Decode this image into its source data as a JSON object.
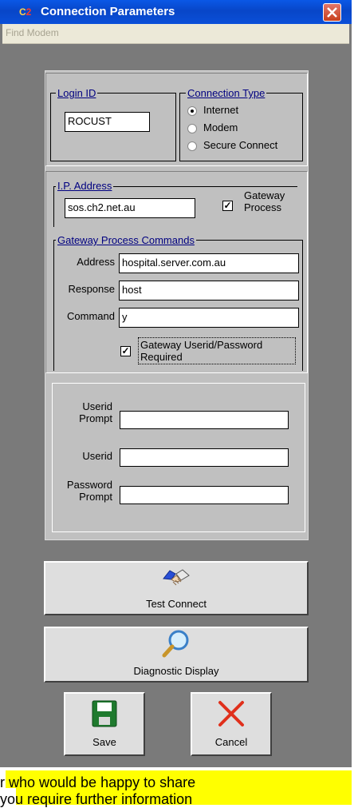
{
  "window": {
    "title": "Connection Parameters",
    "menu": {
      "find_modem": "Find Modem"
    }
  },
  "login": {
    "legend": "Login ID",
    "value": "ROCUST"
  },
  "connection_type": {
    "legend": "Connection Type",
    "options": [
      "Internet",
      "Modem",
      "Secure Connect"
    ],
    "selected": "Internet"
  },
  "ip": {
    "legend": "I.P. Address",
    "value": "sos.ch2.net.au",
    "gateway_process_label": "Gateway Process",
    "gateway_process_checked": true
  },
  "gateway_commands": {
    "legend": "Gateway Process Commands",
    "address_label": "Address",
    "address_value": "hospital.server.com.au",
    "response_label": "Response",
    "response_value": "host",
    "command_label": "Command",
    "command_value": "y",
    "userpass_label": "Gateway Userid/Password Required",
    "userpass_checked": true
  },
  "credentials": {
    "userid_prompt_label": "Userid Prompt",
    "userid_prompt_value": "",
    "userid_label": "Userid",
    "userid_value": "",
    "password_prompt_label": "Password Prompt",
    "password_prompt_value": ""
  },
  "buttons": {
    "test_connect": "Test Connect",
    "diagnostic_display": "Diagnostic Display",
    "save": "Save",
    "cancel": "Cancel"
  },
  "footer": {
    "line1": "r who would be happy to share",
    "line2": " you require further information"
  },
  "colors": {
    "titlebar": "#0a58e6",
    "legend_text": "#000080",
    "highlight": "#ffff00"
  }
}
